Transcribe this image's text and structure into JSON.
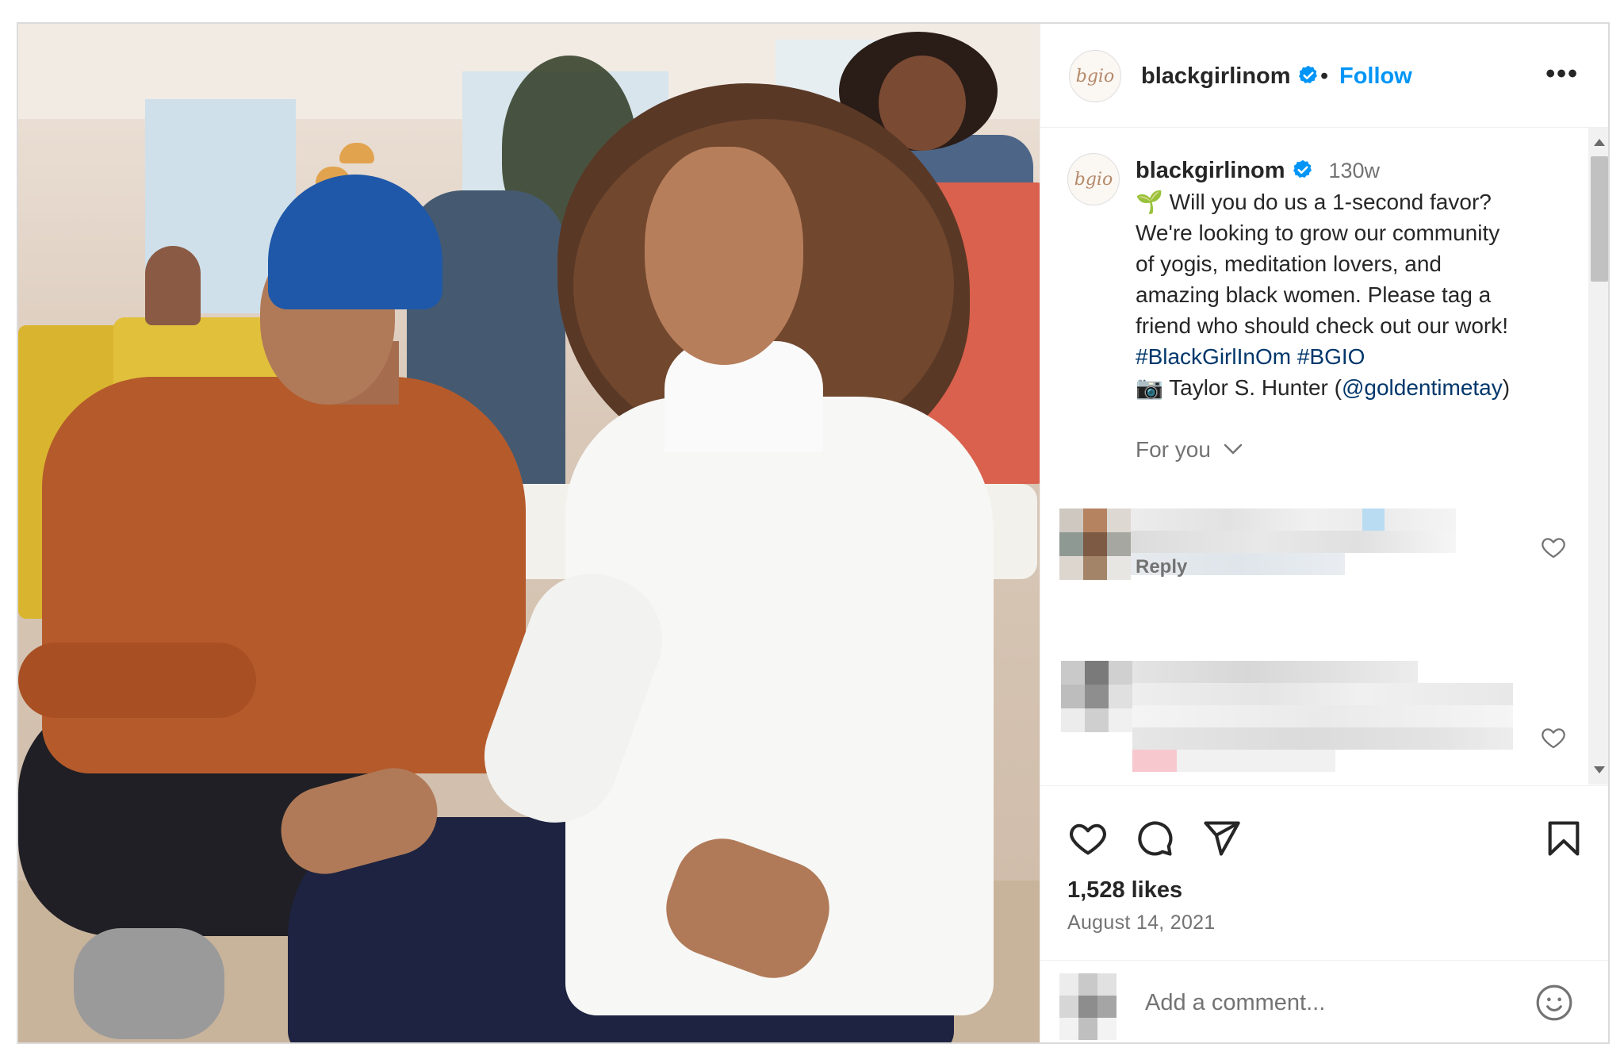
{
  "post": {
    "account": {
      "username": "blackgirlinom",
      "avatar_text": "bgio",
      "verified": true,
      "follow_label": "Follow",
      "separator": "•",
      "more_label": "•••"
    },
    "caption": {
      "username": "blackgirlinom",
      "time_ago": "130w",
      "lines": [
        "🌱 Will you do us a 1-second favor?",
        "We're looking to grow our community",
        "of yogis, meditation lovers, and",
        "amazing black women. Please tag a",
        "friend who should check out our work!"
      ],
      "hashtags": "#BlackGirlInOm #BGIO",
      "credit_prefix": "📷 Taylor S. Hunter (",
      "credit_handle": "@goldentimetay",
      "credit_suffix": ")"
    },
    "comments_filter": {
      "label": "For you",
      "icon": "chevron-down-icon"
    },
    "comments": [
      {
        "reply_label": "Reply"
      }
    ],
    "actions": {
      "icons": [
        "heart-icon",
        "comment-icon",
        "share-icon",
        "bookmark-icon"
      ]
    },
    "likes": "1,528 likes",
    "date": "August 14, 2021",
    "add_comment": {
      "placeholder": "Add a comment...",
      "emoji_icon": "smiley-icon"
    }
  },
  "colors": {
    "link_blue": "#0095f6",
    "hashtag_blue": "#00376b",
    "text_primary": "#262626",
    "text_secondary": "#737373",
    "border": "#dbdbdb"
  }
}
